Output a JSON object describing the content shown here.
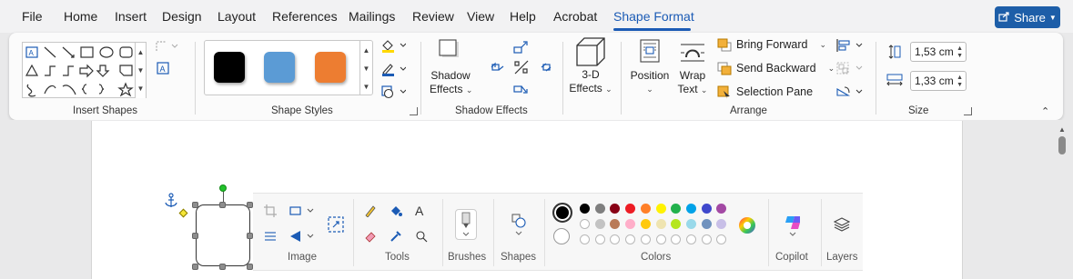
{
  "menu": {
    "items": [
      "File",
      "Home",
      "Insert",
      "Design",
      "Layout",
      "References",
      "Mailings",
      "Review",
      "View",
      "Help",
      "Acrobat",
      "Shape Format"
    ],
    "active": "Shape Format",
    "share_label": "Share"
  },
  "ribbon": {
    "insert_shapes": {
      "group_label": "Insert Shapes"
    },
    "shape_styles": {
      "group_label": "Shape Styles",
      "swatches": [
        "#000000",
        "#5b9bd5",
        "#ed7d31"
      ]
    },
    "shadow_effects": {
      "group_label": "Shadow Effects",
      "shadow_button_line1": "Shadow",
      "shadow_button_line2": "Effects"
    },
    "three_d": {
      "line1": "3-D",
      "line2": "Effects"
    },
    "arrange": {
      "group_label": "Arrange",
      "position_label": "Position",
      "wrap_line1": "Wrap",
      "wrap_line2": "Text",
      "bring_forward": "Bring Forward",
      "send_backward": "Send Backward",
      "selection_pane": "Selection Pane"
    },
    "size": {
      "group_label": "Size",
      "height_value": "1,53 cm",
      "width_value": "1,33 cm"
    }
  },
  "paint_toolbar": {
    "groups": {
      "image": "Image",
      "tools": "Tools",
      "brushes": "Brushes",
      "shapes": "Shapes",
      "colors": "Colors",
      "copilot": "Copilot",
      "layers": "Layers"
    },
    "colors_row1": [
      "#000000",
      "#7f7f7f",
      "#880015",
      "#ed1c24",
      "#ff7f27",
      "#fff200",
      "#22b14c",
      "#00a2e8",
      "#3f48cc",
      "#a349a4"
    ],
    "colors_row2": [
      "#ffffff",
      "#c3c3c3",
      "#b97a57",
      "#ffaec9",
      "#ffc90e",
      "#efe4b0",
      "#b5e61d",
      "#99d9ea",
      "#7092be",
      "#c8bfe7"
    ]
  }
}
